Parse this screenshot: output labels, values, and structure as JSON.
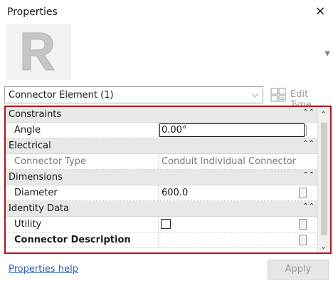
{
  "window": {
    "title": "Properties",
    "close_glyph": "×"
  },
  "preview": {
    "logo_icon": "revit-r-logo",
    "scroll_icon": "chevron-down-icon"
  },
  "type_selector": {
    "selected": "Connector Element (1)",
    "edit_type_label": "Edit Type",
    "edit_type_icon": "edit-type-icon"
  },
  "properties": {
    "groups": [
      {
        "label": "Constraints",
        "rows": [
          {
            "label": "Angle",
            "value": "0.00°",
            "editing": true
          }
        ]
      },
      {
        "label": "Electrical",
        "rows": [
          {
            "label": "Connector Type",
            "value": "Conduit Individual Connector",
            "readonly": true
          }
        ]
      },
      {
        "label": "Dimensions",
        "rows": [
          {
            "label": "Diameter",
            "value": "600.0"
          }
        ]
      },
      {
        "label": "Identity Data",
        "rows": [
          {
            "label": "Utility",
            "value": "",
            "checkbox": true,
            "checked": false
          },
          {
            "label": "Connector Description",
            "value": "",
            "bold": true
          }
        ]
      }
    ],
    "collapse_glyph": "≈"
  },
  "footer": {
    "help_link": "Properties help",
    "apply_label": "Apply"
  },
  "colors": {
    "grid_border": "#b2141e",
    "link": "#2a62b3",
    "group_bg": "#e8e8e8"
  }
}
